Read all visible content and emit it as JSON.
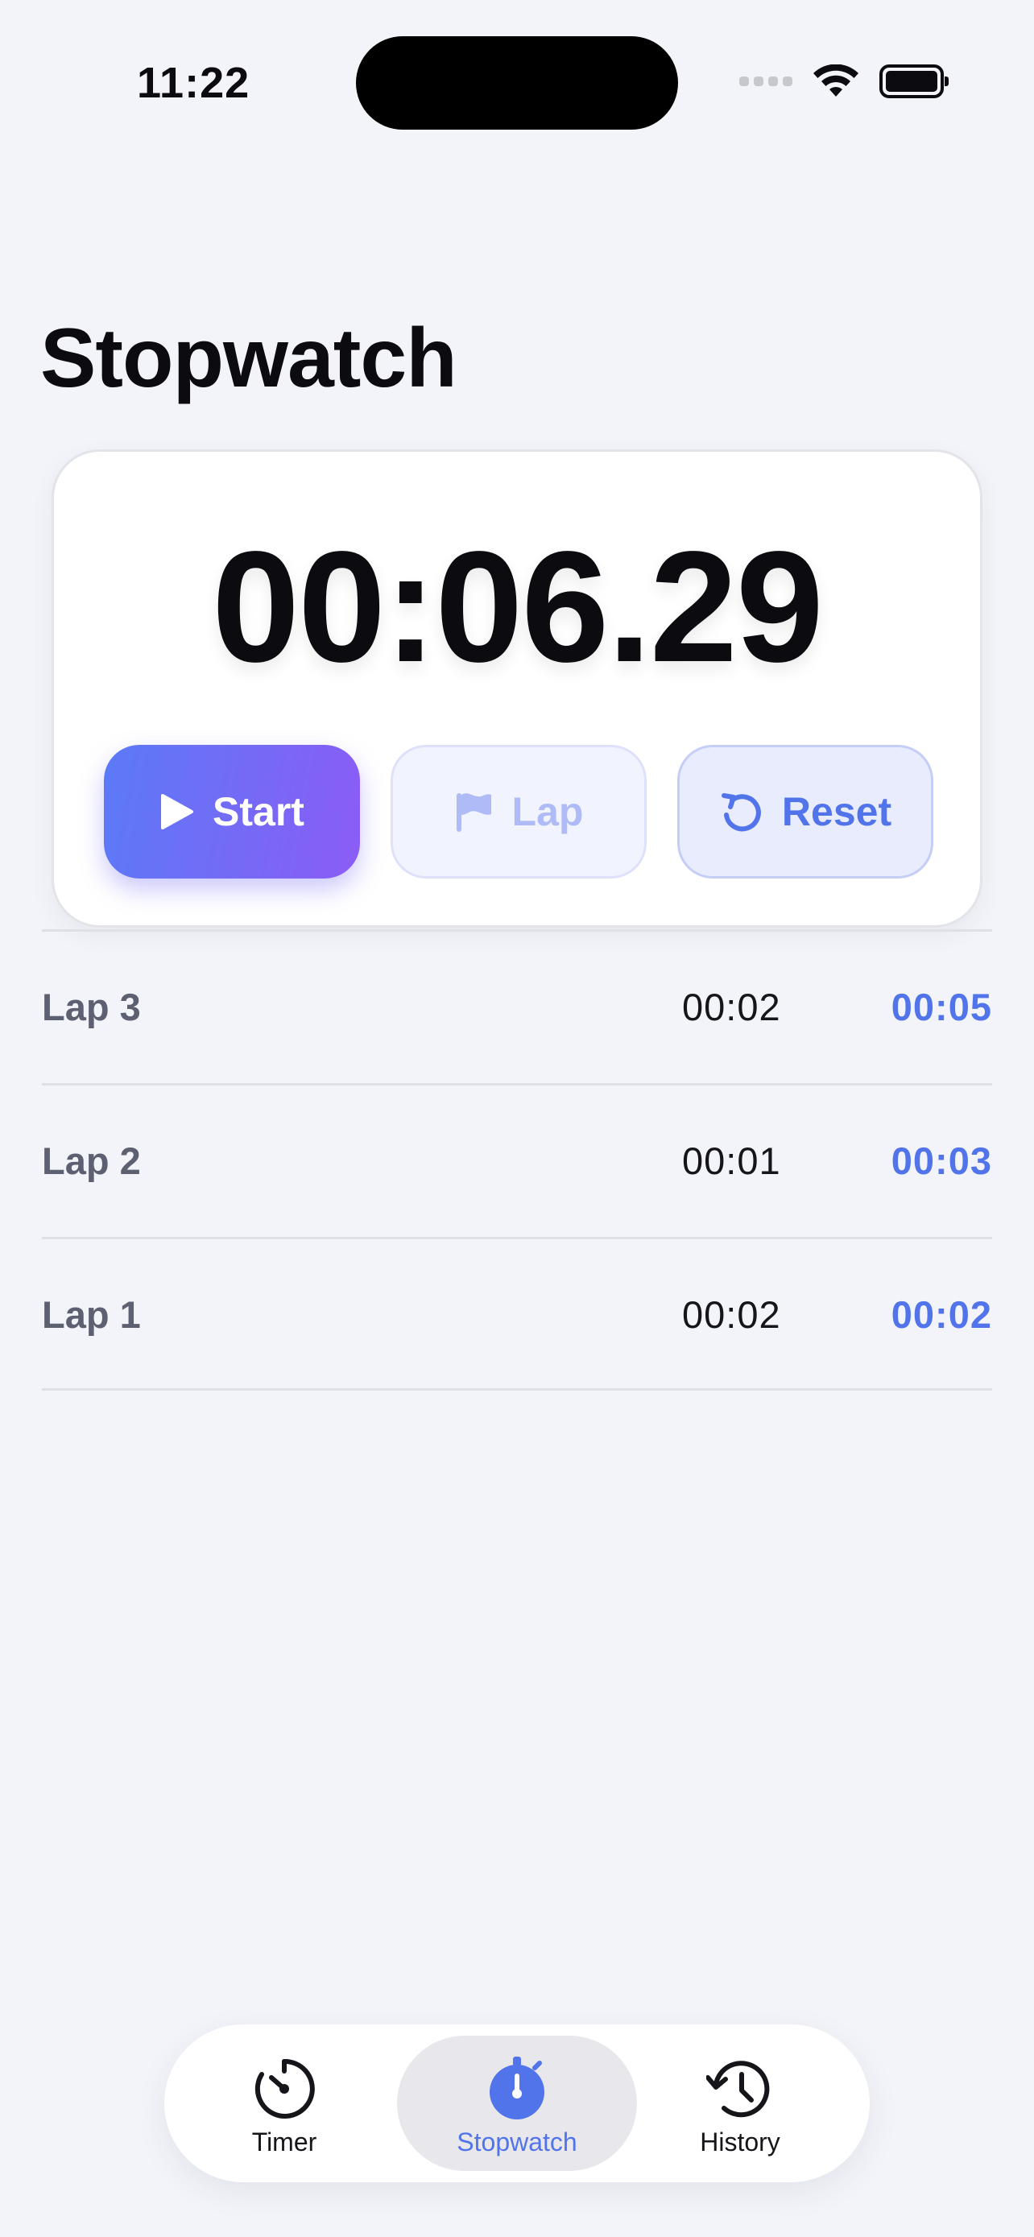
{
  "status_bar": {
    "time": "11:22"
  },
  "title": "Stopwatch",
  "timer": {
    "display": "00:06.29",
    "buttons": {
      "start": "Start",
      "lap": "Lap",
      "reset": "Reset"
    }
  },
  "laps": [
    {
      "label": "Lap 3",
      "split": "00:02",
      "total": "00:05"
    },
    {
      "label": "Lap 2",
      "split": "00:01",
      "total": "00:03"
    },
    {
      "label": "Lap 1",
      "split": "00:02",
      "total": "00:02"
    }
  ],
  "tabs": [
    {
      "label": "Timer",
      "icon": "timer-icon",
      "active": false
    },
    {
      "label": "Stopwatch",
      "icon": "stopwatch-icon",
      "active": true
    },
    {
      "label": "History",
      "icon": "history-icon",
      "active": false
    }
  ],
  "colors": {
    "accent": "#5274ea",
    "start_gradient_start": "#5b7af7",
    "start_gradient_end": "#8b5cf6",
    "background": "#f3f4f9"
  }
}
